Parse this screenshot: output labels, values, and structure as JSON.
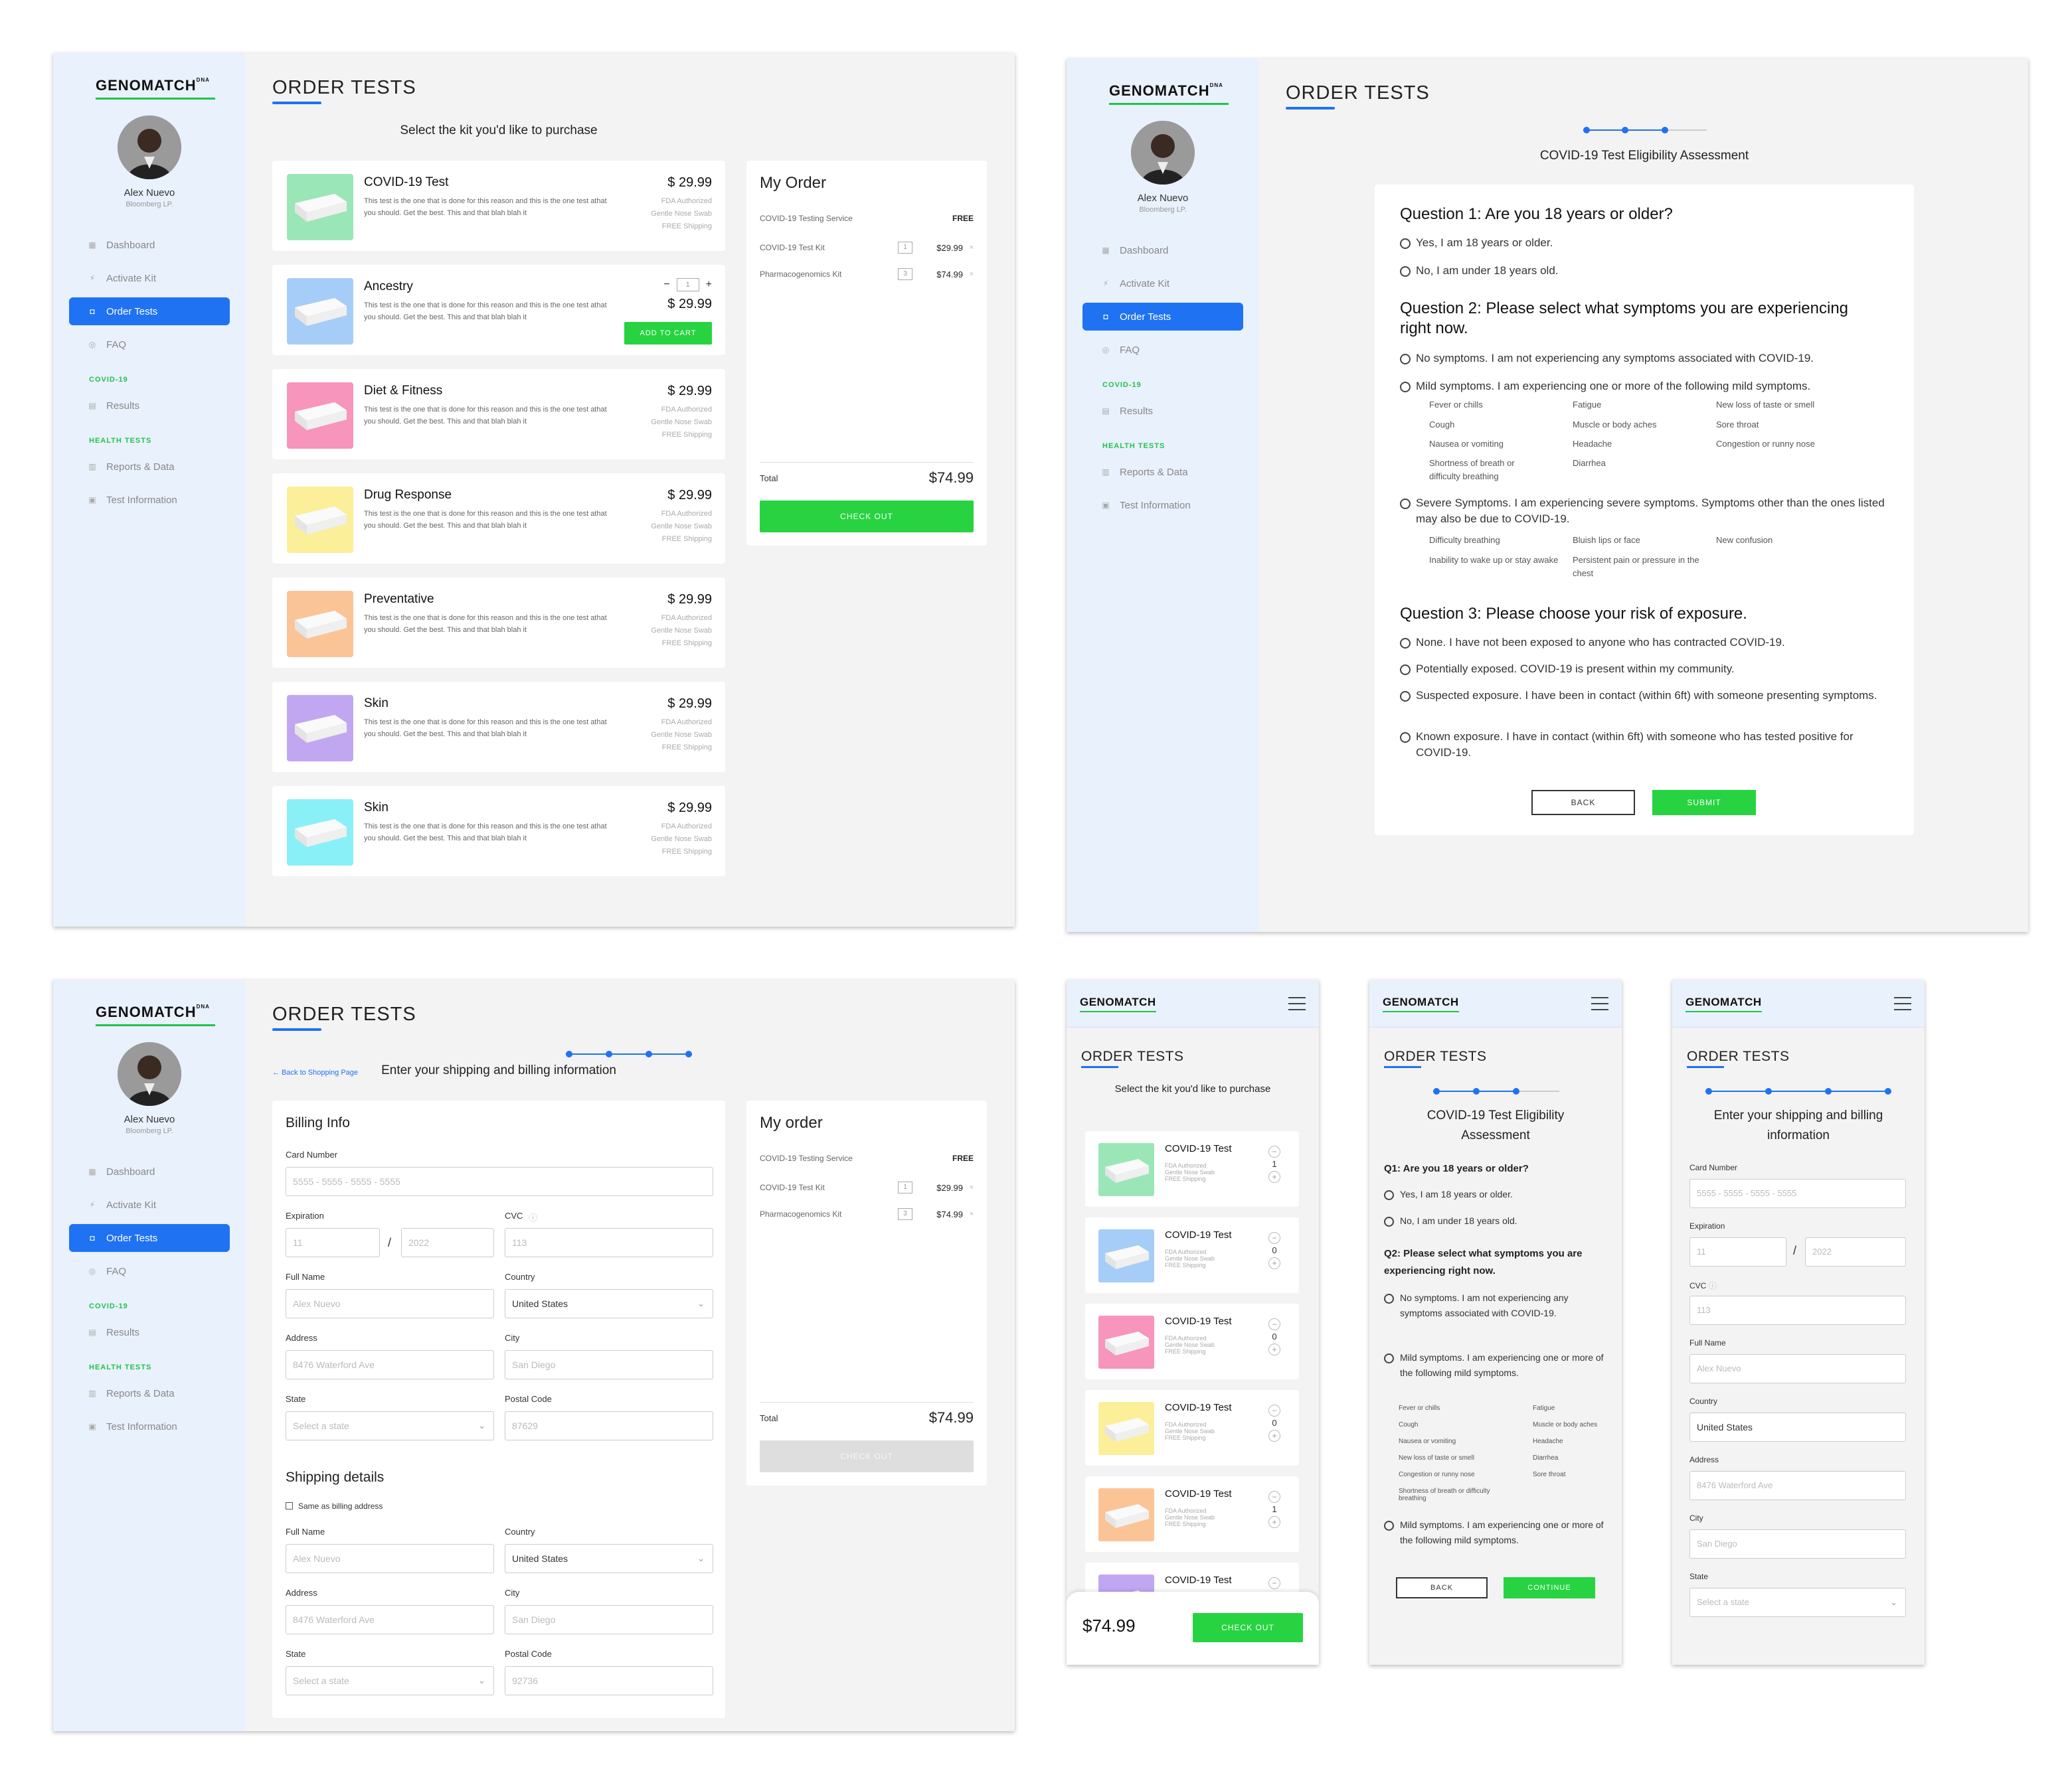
{
  "brand": "GENOMATCH",
  "brand_suffix": "DNA",
  "user": {
    "name": "Alex Nuevo",
    "company": "Bloomberg LP."
  },
  "nav": {
    "dashboard": "Dashboard",
    "activate_kit": "Activate Kit",
    "order_tests": "Order Tests",
    "faq": "FAQ",
    "covid_section": "COVID-19",
    "results": "Results",
    "health_section": "HEALTH TESTS",
    "reports": "Reports & Data",
    "test_info": "Test Information"
  },
  "page_title": "ORDER TESTS",
  "colors": {
    "accent": "#1f72f2",
    "green": "#27d340",
    "sidebar": "#e9f1fc"
  },
  "shop": {
    "subtitle": "Select the kit you'd like to purchase",
    "description": "This test is the one that is done for this reason and this is the one test athat you should.  Get the best. This and that blah blah it",
    "meta1": "FDA Authorized",
    "meta2": "Gentle Nose Swab",
    "meta3": "FREE Shipping",
    "price": "$  29.99",
    "add_to_cart": "ADD TO CART",
    "qty_minus": "−",
    "qty_plus": "+",
    "qty_value": "1",
    "products": [
      {
        "name": "COVID-19 Test",
        "color": "#9be6b7"
      },
      {
        "name": "Ancestry",
        "color": "#a6cdf7"
      },
      {
        "name": "Diet & Fitness",
        "color": "#f795bd"
      },
      {
        "name": "Drug Response",
        "color": "#fbef9a"
      },
      {
        "name": "Preventative",
        "color": "#fbc497"
      },
      {
        "name": "Skin",
        "color": "#c1a7f2"
      },
      {
        "name": "Skin",
        "color": "#8af0f7"
      }
    ]
  },
  "order": {
    "title": "My Order",
    "title_alt": "My order",
    "service": "COVID-19 Testing Service",
    "service_price": "FREE",
    "items": [
      {
        "name": "COVID-19 Test Kit",
        "qty": "1",
        "price": "$29.99"
      },
      {
        "name": "Pharmacogenomics Kit",
        "qty": "3",
        "price": "$74.99"
      }
    ],
    "remove": "×",
    "total_label": "Total",
    "total": "$74.99",
    "checkout": "CHECK OUT"
  },
  "assessment": {
    "title": "COVID-19 Test Eligibility Assessment",
    "q1": "Question 1: Are you 18 years or older?",
    "q1_yes": "Yes, I am 18 years or older.",
    "q1_no": "No, I am under 18 years old.",
    "q2": "Question 2: Please select what symptoms you are experiencing right now.",
    "q2_none": "No symptoms. I am not experiencing any symptoms associated with COVID-19.",
    "q2_mild": "Mild symptoms. I am experiencing one or more of the following mild symptoms.",
    "mild_symptoms": [
      "Fever or chills",
      "Fatigue",
      "New loss of taste or smell",
      "Cough",
      "Muscle or body aches",
      "Sore throat",
      "Nausea or vomiting",
      "Headache",
      "Congestion or runny nose",
      "Shortness of breath or difficulty breathing",
      "Diarrhea"
    ],
    "q2_severe": "Severe Symptoms. I am experiencing severe symptoms. Symptoms other than the ones listed may also be due to COVID-19.",
    "severe_symptoms": [
      "Difficulty breathing",
      "Bluish lips or face",
      "New confusion",
      "Inability to wake up or stay awake",
      "Persistent pain or pressure in the chest"
    ],
    "q3": "Question 3: Please choose your risk of exposure.",
    "q3_none": "None. I have not been exposed to anyone who has contracted COVID-19.",
    "q3_potential": "Potentially exposed. COVID-19 is present within my community.",
    "q3_suspected": "Suspected exposure. I have been in contact (within 6ft) with someone presenting symptoms.",
    "q3_known": "Known exposure. I have in contact (within 6ft)  with someone who has tested positive for COVID-19.",
    "back": "BACK",
    "submit": "SUBMIT"
  },
  "checkout_form": {
    "back_link": "← Back to Shopping Page",
    "subtitle": "Enter your shipping and billing information",
    "billing_title": "Billing Info",
    "card_label": "Card Number",
    "card_ph": "5555 - 5555 - 5555 - 5555",
    "exp_label": "Expiration",
    "exp_month": "11",
    "exp_sep": "/",
    "exp_year": "2022",
    "cvc_label": "CVC",
    "cvc_ph": "113",
    "name_label": "Full Name",
    "name_ph": "Alex Nuevo",
    "country_label": "Country",
    "country_val": "United States",
    "address_label": "Address",
    "address_ph": "8476 Waterford Ave",
    "city_label": "City",
    "city_ph": "San Diego",
    "state_label": "State",
    "state_ph": "Select a state",
    "postal_label": "Postal Code",
    "postal_ph": "87629",
    "postal_ph2": "92736",
    "shipping_title": "Shipping details",
    "same_as_billing": "Same as billing address"
  },
  "mobile": {
    "shop_subtitle": "Select the kit you'd like to purchase",
    "item_name": "COVID-19 Test",
    "item_qtys": [
      "1",
      "0",
      "0",
      "0",
      "1"
    ],
    "item_colors": [
      "#9be6b7",
      "#a6cdf7",
      "#f795bd",
      "#fbef9a",
      "#fbc497",
      "#c1a7f2"
    ],
    "q1": "Q1: Are you 18 years or older?",
    "q2": "Q2: Please select what symptoms you are experiencing right now.",
    "q2_none": "No symptoms. I am not experiencing any symptoms associated with COVID-19.",
    "q2_mild": "Mild symptoms. I am experiencing one or more of the following mild symptoms.",
    "mild_col1": [
      "Fever or chills",
      "Cough",
      "Nausea or vomiting",
      "New loss of taste or smell",
      "Congestion or runny nose",
      "Shortness of breath or difficulty breathing"
    ],
    "mild_col2": [
      "Fatigue",
      "Muscle or body aches",
      "Headache",
      "Diarrhea",
      "Sore throat"
    ],
    "continue": "CONTINUE"
  }
}
